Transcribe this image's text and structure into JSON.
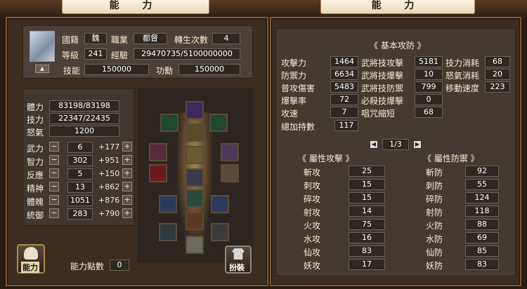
{
  "left_title": "能 力",
  "right_title": "能 力",
  "profile": {
    "guild_label": "國籍",
    "guild_value": "魏",
    "job_label": "職業",
    "job_value": "都督",
    "rebirth_label": "轉生次數",
    "rebirth_value": "4",
    "level_label": "等級",
    "level_value": "241",
    "exp_label": "經驗",
    "exp_value": "29470735/5100000000",
    "skill_label": "技能",
    "skill_value": "150000",
    "merit_label": "功勳",
    "merit_value": "150000"
  },
  "vitals": [
    {
      "label": "體力",
      "value": "83198/83198"
    },
    {
      "label": "技力",
      "value": "22347/22435"
    },
    {
      "label": "怒氣",
      "value": "1200"
    }
  ],
  "attributes": [
    {
      "label": "武力",
      "value": "6",
      "bonus": "+177"
    },
    {
      "label": "智力",
      "value": "302",
      "bonus": "+951"
    },
    {
      "label": "反應",
      "value": "5",
      "bonus": "+150"
    },
    {
      "label": "精神",
      "value": "13",
      "bonus": "+862"
    },
    {
      "label": "體魄",
      "value": "1051",
      "bonus": "+876"
    },
    {
      "label": "統御",
      "value": "283",
      "bonus": "+790"
    }
  ],
  "ability_button": "能力",
  "points_label": "能力點數",
  "points_value": "0",
  "dress_button": "扮裝",
  "basic_header": "《 基本攻防 》",
  "stats_col1": [
    {
      "label": "攻擊力",
      "value": "1464"
    },
    {
      "label": "防禦力",
      "value": "6634"
    },
    {
      "label": "普攻傷害",
      "value": "5483"
    },
    {
      "label": "爆擊率",
      "value": "72"
    },
    {
      "label": "攻速",
      "value": "7"
    },
    {
      "label": "總加持數",
      "value": "117"
    }
  ],
  "stats_col2": [
    {
      "label": "武將技攻擊",
      "value": "5181"
    },
    {
      "label": "武將技爆擊",
      "value": "10"
    },
    {
      "label": "武將技防禦",
      "value": "799"
    },
    {
      "label": "必殺技爆擊",
      "value": "0"
    },
    {
      "label": "唱咒縮短",
      "value": "68"
    }
  ],
  "stats_col3": [
    {
      "label": "技力消耗",
      "value": "68"
    },
    {
      "label": "怒氣消耗",
      "value": "20"
    },
    {
      "label": "移動速度",
      "value": "223"
    }
  ],
  "pager": "1/3",
  "attack_header": "《 屬性攻擊 》",
  "defense_header": "《 屬性防禦 》",
  "attack": [
    {
      "label": "斬攻",
      "value": "25"
    },
    {
      "label": "刺攻",
      "value": "15"
    },
    {
      "label": "碎攻",
      "value": "15"
    },
    {
      "label": "射攻",
      "value": "14"
    },
    {
      "label": "火攻",
      "value": "75"
    },
    {
      "label": "水攻",
      "value": "16"
    },
    {
      "label": "仙攻",
      "value": "83"
    },
    {
      "label": "妖攻",
      "value": "17"
    }
  ],
  "defense": [
    {
      "label": "斬防",
      "value": "92"
    },
    {
      "label": "刺防",
      "value": "55"
    },
    {
      "label": "碎防",
      "value": "124"
    },
    {
      "label": "射防",
      "value": "118"
    },
    {
      "label": "火防",
      "value": "88"
    },
    {
      "label": "水防",
      "value": "69"
    },
    {
      "label": "仙防",
      "value": "85"
    },
    {
      "label": "妖防",
      "value": "83"
    }
  ]
}
